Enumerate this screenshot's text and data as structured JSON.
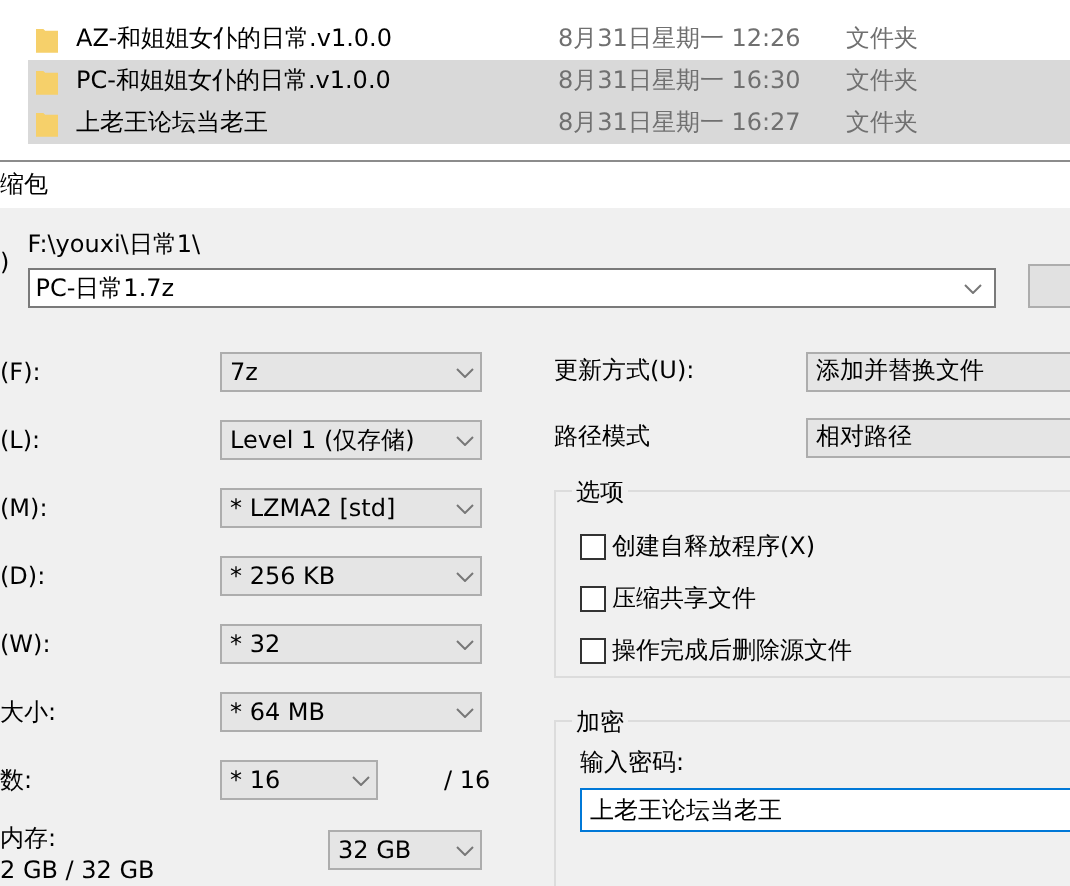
{
  "files": [
    {
      "name": "AZ-和姐姐女仆的日常.v1.0.0",
      "date": "8月31日星期一 12:26",
      "type": "文件夹",
      "selected": false
    },
    {
      "name": "PC-和姐姐女仆的日常.v1.0.0",
      "date": "8月31日星期一 16:30",
      "type": "文件夹",
      "selected": true
    },
    {
      "name": "上老王论坛当老王",
      "date": "8月31日星期一 16:27",
      "type": "文件夹",
      "selected": true
    }
  ],
  "dialog": {
    "title": "缩包",
    "archive_label": ")",
    "path": "F:\\youxi\\日常1\\",
    "archive_name": "PC-日常1.7z",
    "left_fields": [
      {
        "label": "(F):",
        "value": "7z"
      },
      {
        "label": "(L):",
        "value": "Level 1 (仅存储)"
      },
      {
        "label": "(M):",
        "value": "* LZMA2 [std]"
      },
      {
        "label": "(D):",
        "value": "* 256 KB"
      },
      {
        "label": "(W):",
        "value": "* 32"
      },
      {
        "label": "大小:",
        "value": "* 64 MB"
      }
    ],
    "threads": {
      "label": "数:",
      "value": "* 16",
      "total": "/ 16"
    },
    "memory": {
      "label": "内存:",
      "usage": "2 GB / 32 GB",
      "value": "32 GB"
    },
    "update_mode": {
      "label": "更新方式(U):",
      "value": "添加并替换文件"
    },
    "path_mode": {
      "label": "路径模式",
      "value": "相对路径"
    },
    "options": {
      "title": "选项",
      "items": [
        {
          "label": "创建自释放程序(X)",
          "checked": false
        },
        {
          "label": "压缩共享文件",
          "checked": false
        },
        {
          "label": "操作完成后删除源文件",
          "checked": false
        }
      ]
    },
    "encryption": {
      "title": "加密",
      "label": "输入密码:",
      "password": "上老王论坛当老王"
    }
  }
}
